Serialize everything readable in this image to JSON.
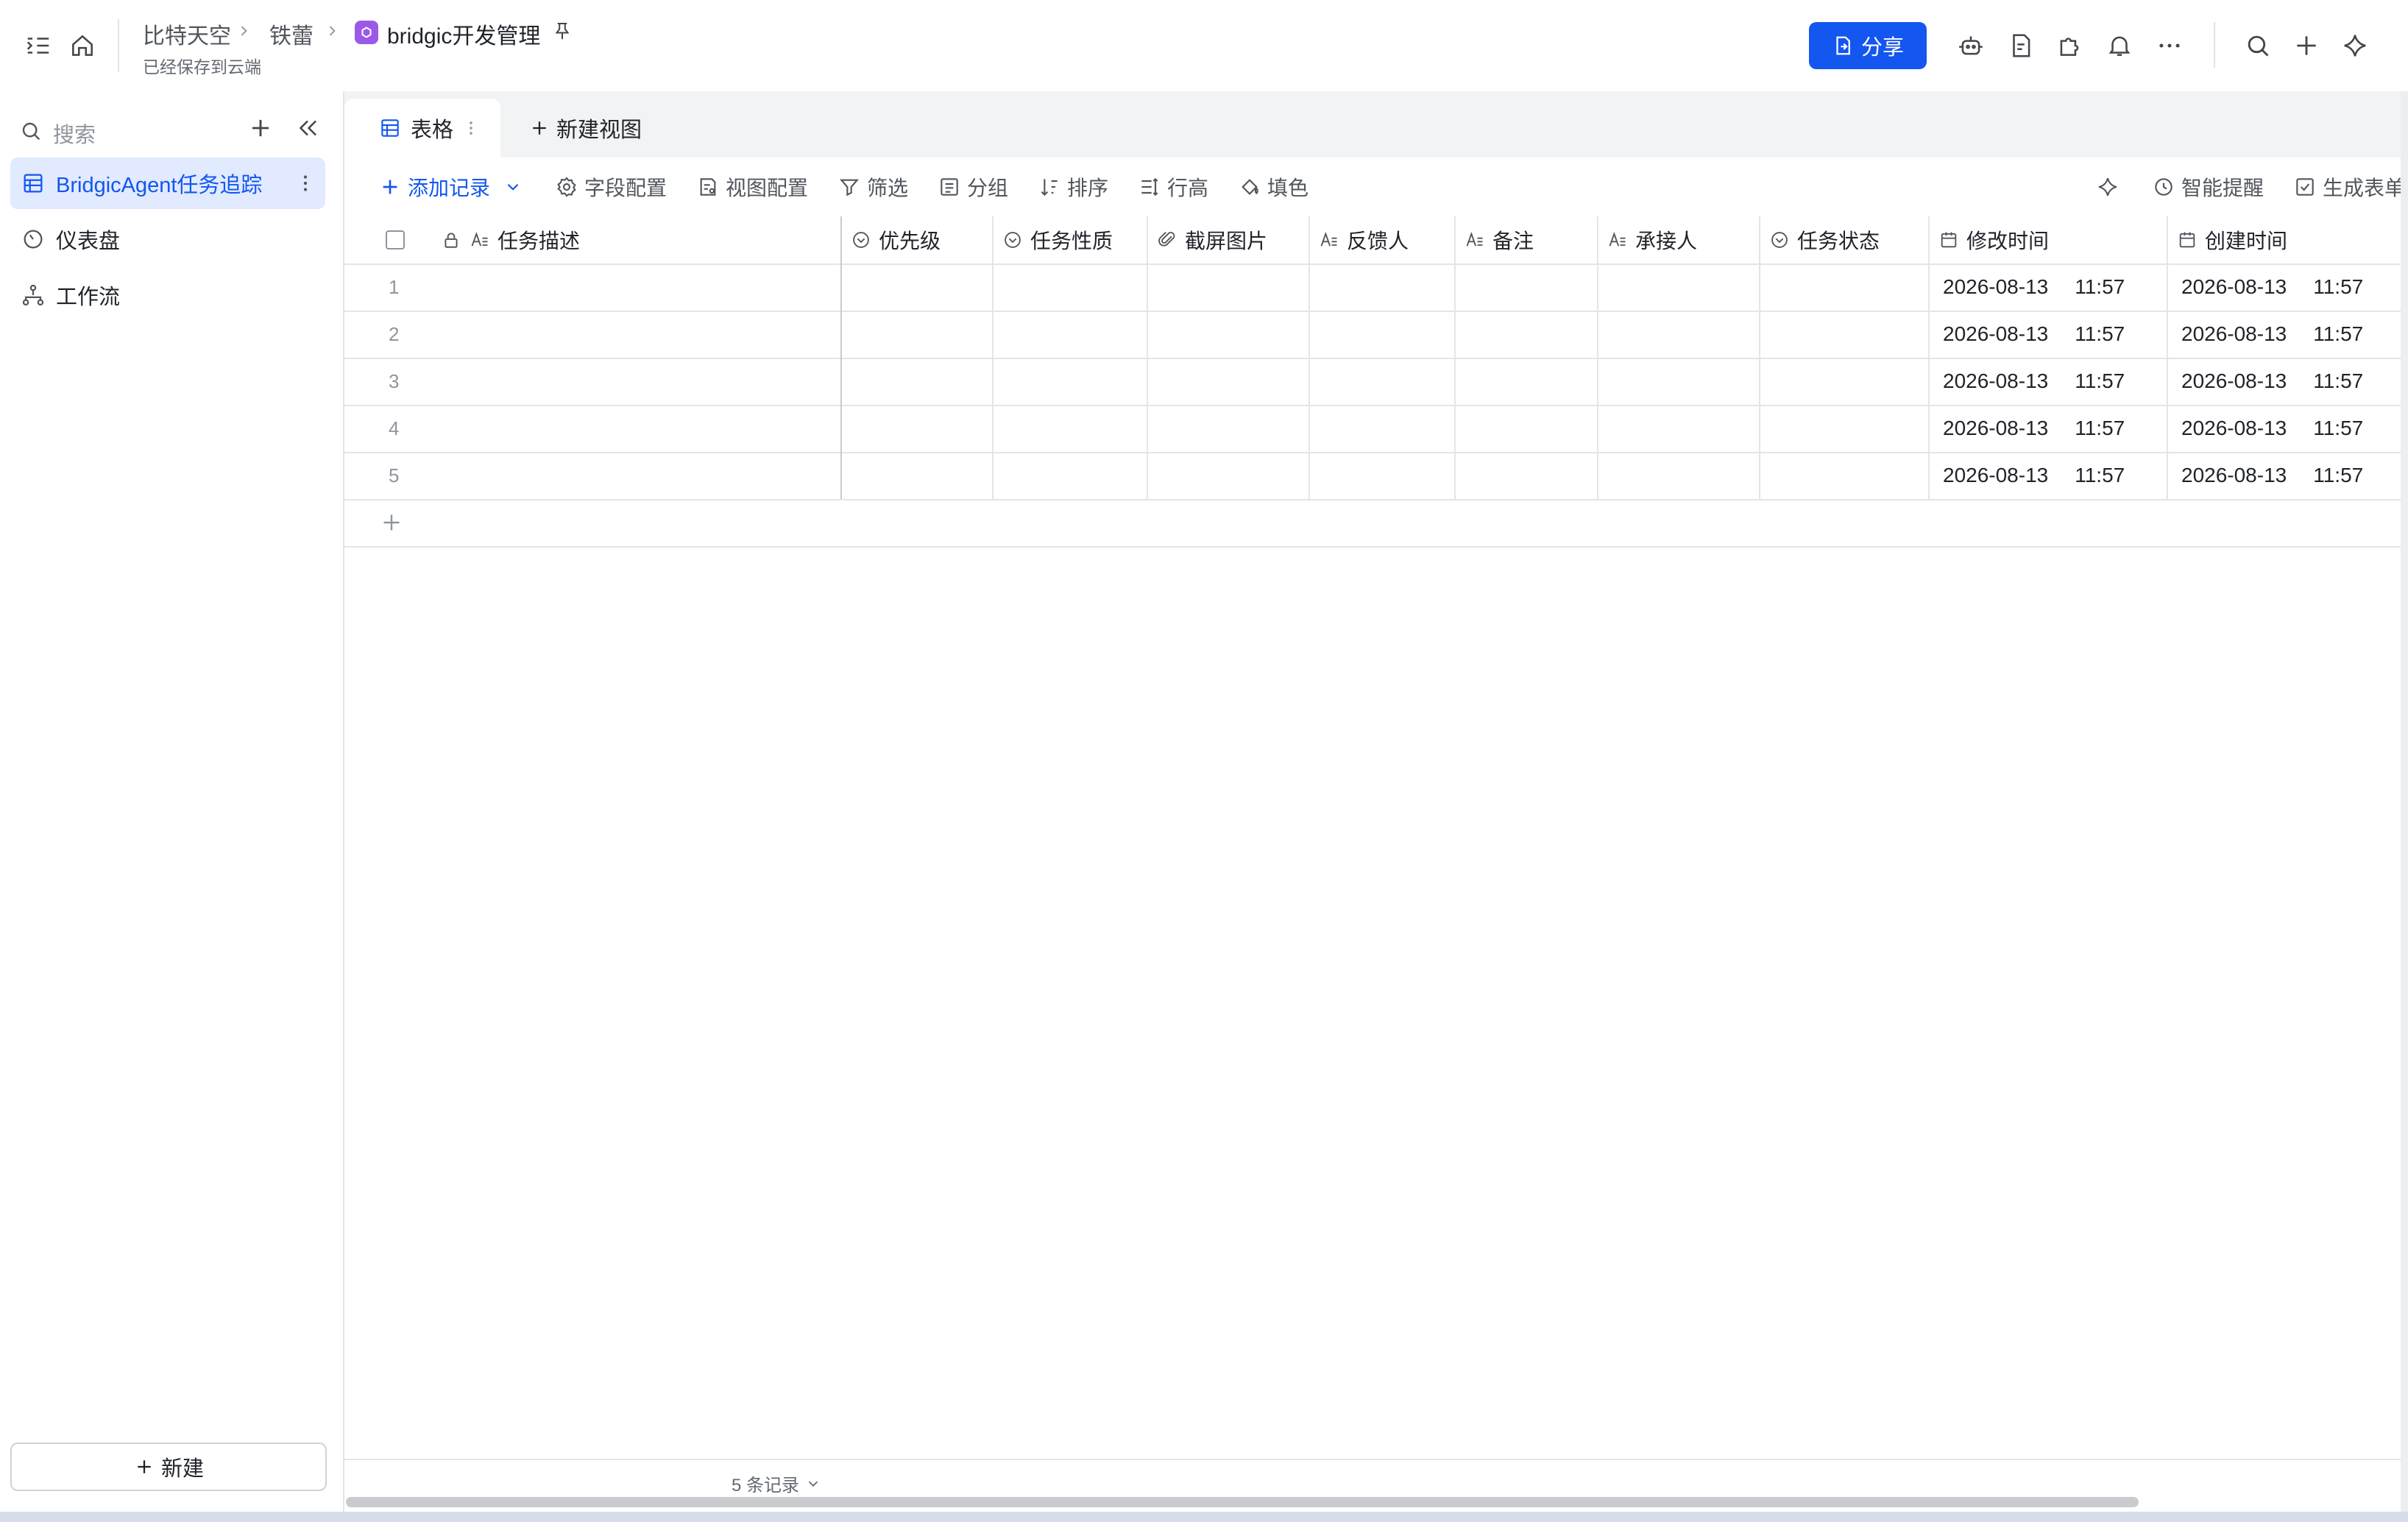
{
  "header": {
    "breadcrumbs": [
      "比特天空",
      "铁蕾"
    ],
    "doc_title": "bridgic开发管理",
    "save_status": "已经保存到云端",
    "share_label": "分享",
    "brand_color": "#1456f0"
  },
  "sidebar": {
    "search_placeholder": "搜索",
    "items": [
      {
        "label": "BridgicAgent任务追踪",
        "icon": "table-icon",
        "active": true
      },
      {
        "label": "仪表盘",
        "icon": "dashboard-icon",
        "active": false
      },
      {
        "label": "工作流",
        "icon": "workflow-icon",
        "active": false
      }
    ],
    "new_label": "新建"
  },
  "view_tabs": {
    "grid_label": "表格",
    "new_view_label": "新建视图"
  },
  "toolbar": {
    "add_record": "添加记录",
    "field_config": "字段配置",
    "view_config": "视图配置",
    "filter": "筛选",
    "group": "分组",
    "sort": "排序",
    "row_height": "行高",
    "fill": "填色",
    "smart_reminder": "智能提醒",
    "generate_form": "生成表单"
  },
  "table": {
    "columns": [
      {
        "label": "任务描述",
        "icon": "text-field-icon"
      },
      {
        "label": "优先级",
        "icon": "single-select-icon"
      },
      {
        "label": "任务性质",
        "icon": "single-select-icon"
      },
      {
        "label": "截屏图片",
        "icon": "attachment-icon"
      },
      {
        "label": "反馈人",
        "icon": "text-field-icon"
      },
      {
        "label": "备注",
        "icon": "text-field-icon"
      },
      {
        "label": "承接人",
        "icon": "text-field-icon"
      },
      {
        "label": "任务状态",
        "icon": "single-select-icon"
      },
      {
        "label": "修改时间",
        "icon": "calendar-icon"
      },
      {
        "label": "创建时间",
        "icon": "calendar-icon"
      }
    ],
    "rows": [
      {
        "num": "1",
        "modified_date": "2026-08-13",
        "modified_time": "11:57",
        "created_date": "2026-08-13",
        "created_time": "11:57"
      },
      {
        "num": "2",
        "modified_date": "2026-08-13",
        "modified_time": "11:57",
        "created_date": "2026-08-13",
        "created_time": "11:57"
      },
      {
        "num": "3",
        "modified_date": "2026-08-13",
        "modified_time": "11:57",
        "created_date": "2026-08-13",
        "created_time": "11:57"
      },
      {
        "num": "4",
        "modified_date": "2026-08-13",
        "modified_time": "11:57",
        "created_date": "2026-08-13",
        "created_time": "11:57"
      },
      {
        "num": "5",
        "modified_date": "2026-08-13",
        "modified_time": "11:57",
        "created_date": "2026-08-13",
        "created_time": "11:57"
      }
    ],
    "record_count": "5 条记录"
  }
}
